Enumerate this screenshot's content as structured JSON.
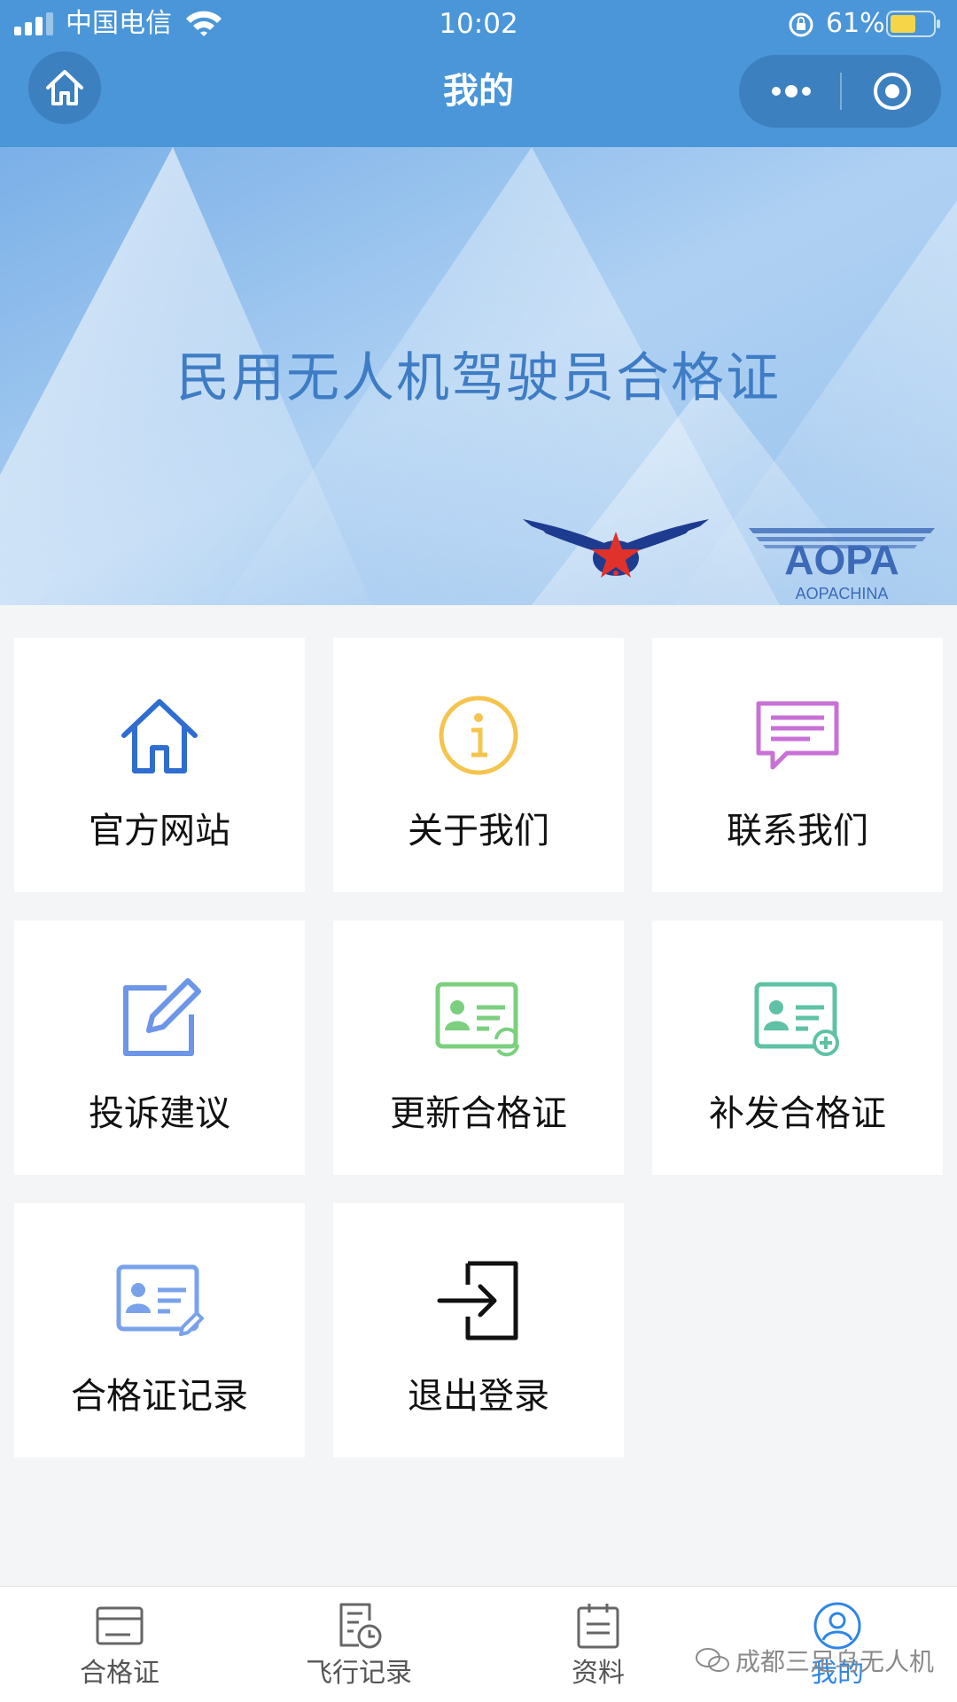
{
  "status_bar": {
    "carrier": "中国电信",
    "time": "10:02",
    "battery": "61%"
  },
  "nav": {
    "title": "我的"
  },
  "banner": {
    "title": "民用无人机驾驶员合格证",
    "logo_text": "AOPA",
    "logo_subtext": "AOPACHINA"
  },
  "menu": {
    "items": [
      {
        "label": "官方网站",
        "icon": "home-icon"
      },
      {
        "label": "关于我们",
        "icon": "info-icon"
      },
      {
        "label": "联系我们",
        "icon": "message-icon"
      },
      {
        "label": "投诉建议",
        "icon": "edit-icon"
      },
      {
        "label": "更新合格证",
        "icon": "card-refresh-icon"
      },
      {
        "label": "补发合格证",
        "icon": "card-add-icon"
      },
      {
        "label": "合格证记录",
        "icon": "card-edit-icon"
      },
      {
        "label": "退出登录",
        "icon": "logout-icon"
      }
    ]
  },
  "tabbar": {
    "tabs": [
      {
        "label": "合格证",
        "icon": "certificate-icon"
      },
      {
        "label": "飞行记录",
        "icon": "flight-record-icon"
      },
      {
        "label": "资料",
        "icon": "document-icon"
      },
      {
        "label": "我的",
        "icon": "user-icon"
      }
    ],
    "active_tab": "我的"
  },
  "watermark": "成都三足乌无人机",
  "colors": {
    "nav_bg": "#4a96d8",
    "accent": "#2f86e6",
    "banner_text": "#3e7cc5"
  }
}
